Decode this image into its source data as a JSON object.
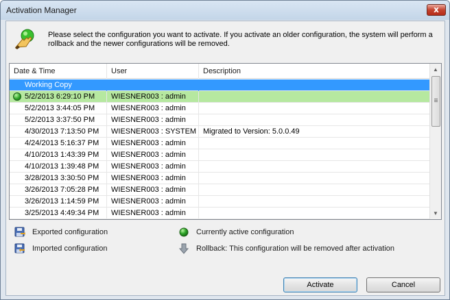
{
  "window": {
    "title": "Activation Manager",
    "close_glyph": "x"
  },
  "instruction": "Please select the configuration you want to activate. If you activate an older configuration, the system will perform a rollback and the newer configurations will be removed.",
  "table": {
    "columns": [
      "Date & Time",
      "User",
      "Description"
    ],
    "rows": [
      {
        "datetime": "Working Copy",
        "user": "",
        "description": "",
        "state": "selected"
      },
      {
        "datetime": "5/2/2013 6:29:10 PM",
        "user": "WIESNER003 : admin",
        "description": "",
        "state": "active"
      },
      {
        "datetime": "5/2/2013 3:44:05 PM",
        "user": "WIESNER003 : admin",
        "description": "",
        "state": ""
      },
      {
        "datetime": "5/2/2013 3:37:50 PM",
        "user": "WIESNER003 : admin",
        "description": "",
        "state": ""
      },
      {
        "datetime": "4/30/2013 7:13:50 PM",
        "user": "WIESNER003 : SYSTEM",
        "description": "Migrated to Version: 5.0.0.49",
        "state": ""
      },
      {
        "datetime": "4/24/2013 5:16:37 PM",
        "user": "WIESNER003 : admin",
        "description": "",
        "state": ""
      },
      {
        "datetime": "4/10/2013 1:43:39 PM",
        "user": "WIESNER003 : admin",
        "description": "",
        "state": ""
      },
      {
        "datetime": "4/10/2013 1:39:48 PM",
        "user": "WIESNER003 : admin",
        "description": "",
        "state": ""
      },
      {
        "datetime": "3/28/2013 3:30:50 PM",
        "user": "WIESNER003 : admin",
        "description": "",
        "state": ""
      },
      {
        "datetime": "3/26/2013 7:05:28 PM",
        "user": "WIESNER003 : admin",
        "description": "",
        "state": ""
      },
      {
        "datetime": "3/26/2013 1:14:59 PM",
        "user": "WIESNER003 : admin",
        "description": "",
        "state": ""
      },
      {
        "datetime": "3/25/2013 4:49:34 PM",
        "user": "WIESNER003 : admin",
        "description": "",
        "state": ""
      }
    ]
  },
  "legend": {
    "exported": "Exported configuration",
    "imported": "Imported configuration",
    "active": "Currently active configuration",
    "rollback": "Rollback: This configuration will be removed after activation"
  },
  "buttons": {
    "activate": "Activate",
    "cancel": "Cancel"
  },
  "colors": {
    "selected_row": "#3399ff",
    "active_row": "#b6e8a0",
    "active_dot": "#2fa52a"
  },
  "icons": {
    "instruction": "hand-pointer-icon",
    "exported": "floppy-export-icon",
    "imported": "floppy-import-icon",
    "active": "green-circle-icon",
    "rollback": "down-arrow-icon"
  }
}
